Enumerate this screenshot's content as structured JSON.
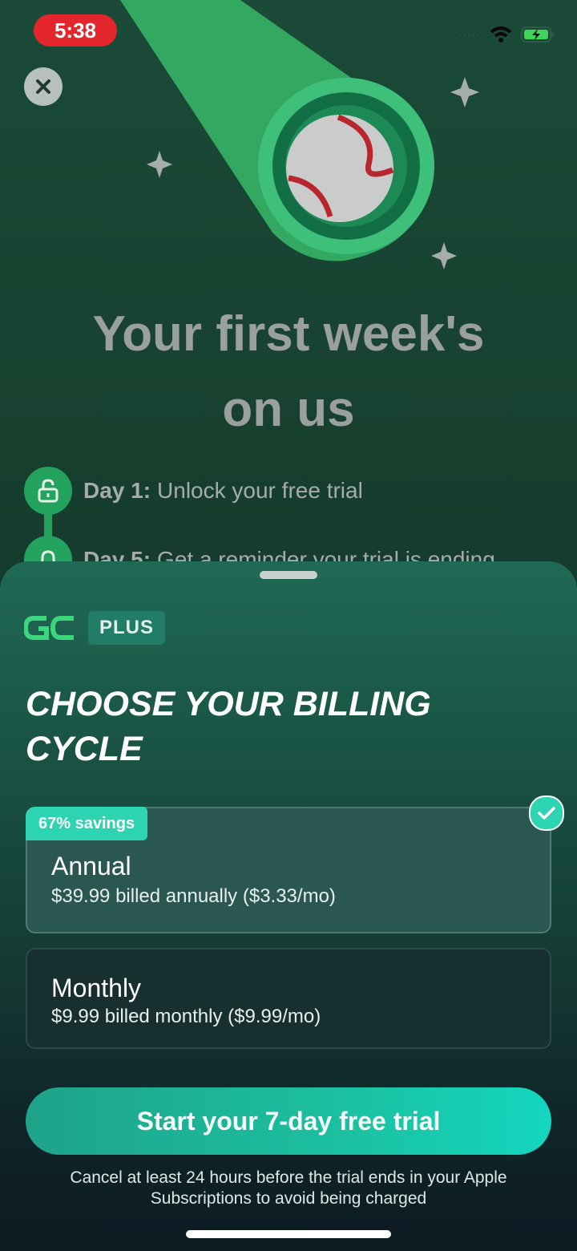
{
  "status_bar": {
    "time": "5:38",
    "signal_dots": "·····"
  },
  "hero": {
    "title_line1": "Your first week's",
    "title_line2": "on us"
  },
  "timeline": [
    {
      "day": "Day 1:",
      "text": "Unlock your free trial"
    },
    {
      "day": "Day 5:",
      "text": "Get a reminder your trial is ending"
    }
  ],
  "sheet": {
    "brand_badge": "PLUS",
    "title": "CHOOSE YOUR BILLING CYCLE",
    "plans": [
      {
        "badge": "67% savings",
        "name": "Annual",
        "desc": "$39.99 billed annually ($3.33/mo)",
        "selected": true
      },
      {
        "name": "Monthly",
        "desc": "$9.99 billed monthly ($9.99/mo)",
        "selected": false
      }
    ],
    "cta": "Start your 7-day free trial",
    "disclaimer": "Cancel at least 24 hours before the trial ends in your Apple Subscriptions to avoid being charged"
  },
  "colors": {
    "accent": "#2dd4b2",
    "brand_green": "#3bd67d",
    "status_red": "#e3262b"
  }
}
